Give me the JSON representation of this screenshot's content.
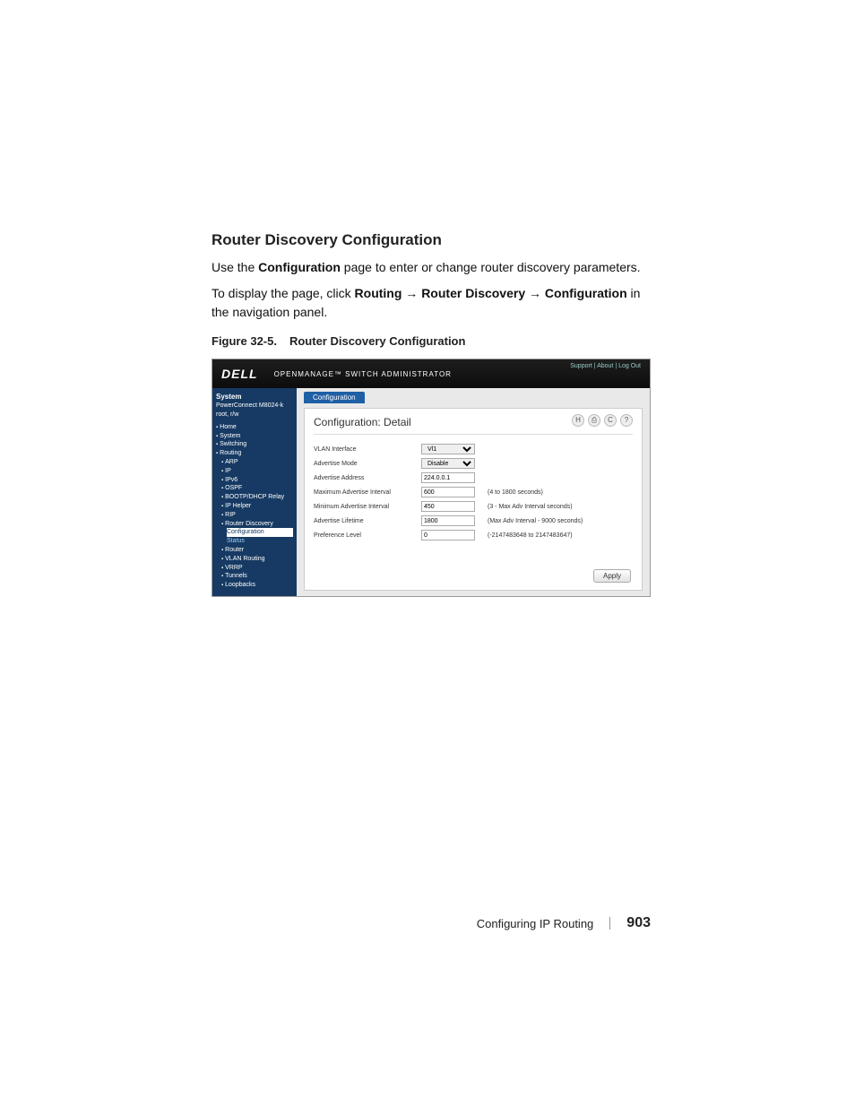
{
  "section": {
    "heading": "Router Discovery Configuration",
    "para1_full": "Use the Configuration page to enter or change router discovery parameters.",
    "para1_pre": "Use the ",
    "para1_bold": "Configuration",
    "para1_post": " page to enter or change router discovery parameters.",
    "para2_pre": "To display the page, click ",
    "para2_b1": "Routing",
    "para2_b2": "Router Discovery",
    "para2_b3": "Configuration",
    "para2_post": " in the navigation panel."
  },
  "figure": {
    "number": "Figure 32-5.",
    "title": "Router Discovery Configuration"
  },
  "footer": {
    "chapter": "Configuring IP Routing",
    "page": "903"
  },
  "screenshot": {
    "brand": "DELL",
    "product": "OPENMANAGE™ SWITCH ADMINISTRATOR",
    "toplinks": "Support | About | Log Out",
    "side": {
      "system": "System",
      "device": "PowerConnect M8024-k",
      "user": "root, r/w",
      "items": [
        {
          "label": "Home",
          "indent": 0,
          "sel": false
        },
        {
          "label": "System",
          "indent": 0,
          "sel": false
        },
        {
          "label": "Switching",
          "indent": 0,
          "sel": false
        },
        {
          "label": "Routing",
          "indent": 0,
          "sel": false
        },
        {
          "label": "ARP",
          "indent": 1,
          "sel": false
        },
        {
          "label": "IP",
          "indent": 1,
          "sel": false
        },
        {
          "label": "IPv6",
          "indent": 1,
          "sel": false
        },
        {
          "label": "OSPF",
          "indent": 1,
          "sel": false
        },
        {
          "label": "BOOTP/DHCP Relay",
          "indent": 1,
          "sel": false
        },
        {
          "label": "IP Helper",
          "indent": 1,
          "sel": false
        },
        {
          "label": "RIP",
          "indent": 1,
          "sel": false
        },
        {
          "label": "Router Discovery",
          "indent": 1,
          "sel": false
        },
        {
          "label": "Configuration",
          "indent": 2,
          "sel": true
        },
        {
          "label": "Status",
          "indent": 2,
          "sel": false,
          "hl": true
        },
        {
          "label": "Router",
          "indent": 1,
          "sel": false
        },
        {
          "label": "VLAN Routing",
          "indent": 1,
          "sel": false
        },
        {
          "label": "VRRP",
          "indent": 1,
          "sel": false
        },
        {
          "label": "Tunnels",
          "indent": 1,
          "sel": false
        },
        {
          "label": "Loopbacks",
          "indent": 1,
          "sel": false
        }
      ]
    },
    "tab": "Configuration",
    "panel_title": "Configuration: Detail",
    "icons": {
      "save": "H",
      "print": "⎙",
      "refresh": "C",
      "help": "?"
    },
    "rows": [
      {
        "label": "VLAN Interface",
        "type": "select",
        "value": "Vl1",
        "hint": ""
      },
      {
        "label": "Advertise Mode",
        "type": "select",
        "value": "Disable",
        "hint": ""
      },
      {
        "label": "Advertise Address",
        "type": "input",
        "value": "224.0.0.1",
        "hint": ""
      },
      {
        "label": "Maximum Advertise Interval",
        "type": "input",
        "value": "600",
        "hint": "(4 to 1800 seconds)"
      },
      {
        "label": "Minimum Advertise Interval",
        "type": "input",
        "value": "450",
        "hint": "(3 - Max Adv Interval seconds)"
      },
      {
        "label": "Advertise Lifetime",
        "type": "input",
        "value": "1800",
        "hint": "(Max Adv Interval - 9000 seconds)"
      },
      {
        "label": "Preference Level",
        "type": "input",
        "value": "0",
        "hint": "(-2147483648 to 2147483647)"
      }
    ],
    "apply": "Apply"
  }
}
